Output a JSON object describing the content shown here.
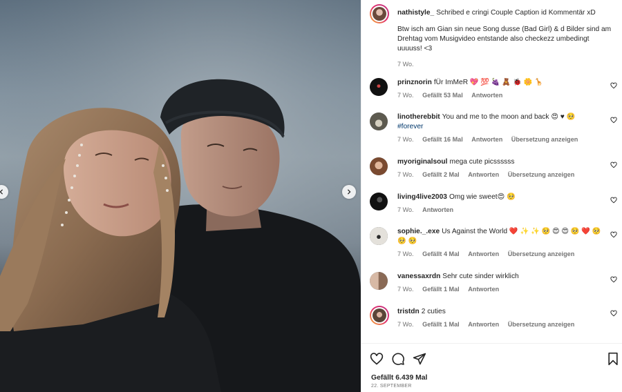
{
  "post": {
    "author": "nathistyle_",
    "caption_line1": "Schribed e cringi Couple Caption id Kommentär xD",
    "caption_body": "Btw isch am Gian sin neue Song dusse (Bad Girl) & d Bilder sind am Drehtag vom Musigvideo entstande also checkezz umbedingt uuuuss! <3",
    "time": "7 Wo."
  },
  "comments": [
    {
      "user": "prinznorin",
      "text": "fÜr ImMeR 💖 💯 🍇 🧸 🐞 🌼 🦒",
      "time": "7 Wo.",
      "likes": "Gefällt 53 Mal",
      "reply": "Antworten",
      "translate": "",
      "avatar_color": "#1a1a1a"
    },
    {
      "user": "linotherebbit",
      "text": "You and me to the moon and back 😍 ♥ 🥺",
      "hashtag": "#forever",
      "time": "7 Wo.",
      "likes": "Gefällt 16 Mal",
      "reply": "Antworten",
      "translate": "Übersetzung anzeigen",
      "avatar_color": "#8d8a7c"
    },
    {
      "user": "myoriginalsoul",
      "text": "mega cute picssssss",
      "time": "7 Wo.",
      "likes": "Gefällt 2 Mal",
      "reply": "Antworten",
      "translate": "Übersetzung anzeigen",
      "avatar_color": "#9b6a4d"
    },
    {
      "user": "living4live2003",
      "text": "Omg wie sweet😍 🥺",
      "time": "7 Wo.",
      "likes": "",
      "reply": "Antworten",
      "translate": "",
      "avatar_color": "#222222"
    },
    {
      "user": "sophie._.exe",
      "text": "Us Against the World ❤️ ✨ ✨ 🥺 😍 😍 🥺 ❤️ 🥺 🥺 🥺",
      "time": "7 Wo.",
      "likes": "Gefällt 4 Mal",
      "reply": "Antworten",
      "translate": "Übersetzung anzeigen",
      "avatar_color": "#d9d6d0"
    },
    {
      "user": "vanessaxrdn",
      "text": "Sehr cute sinder wirklich",
      "time": "7 Wo.",
      "likes": "Gefällt 1 Mal",
      "reply": "Antworten",
      "translate": "",
      "avatar_color": "#b89a86"
    },
    {
      "user": "tristdn",
      "text": "2 cuties",
      "time": "7 Wo.",
      "likes": "Gefällt 1 Mal",
      "reply": "Antworten",
      "translate": "Übersetzung anzeigen",
      "avatar_color": "#7a6a5c"
    }
  ],
  "footer": {
    "likes": "Gefällt 6.439 Mal",
    "date": "22. SEPTEMBER"
  },
  "icons": {
    "heart": "heart-icon",
    "comment": "comment-icon",
    "share": "share-icon",
    "save": "bookmark-icon",
    "prev": "chevron-left-icon",
    "next": "chevron-right-icon"
  },
  "colors": {
    "text": "#262626",
    "muted": "#737373",
    "hashtag": "#00376b",
    "like_red": "#ed4956"
  }
}
